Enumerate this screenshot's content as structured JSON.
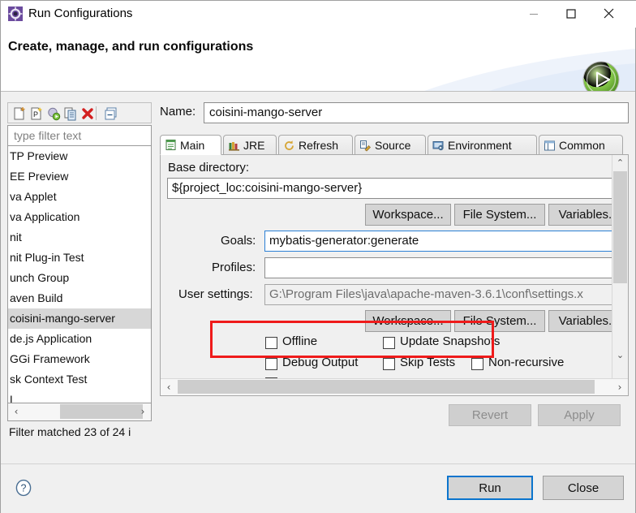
{
  "window": {
    "title": "Run Configurations",
    "title_icon": "gear-icon",
    "controls": {
      "minimize": "—",
      "maximize": "☐",
      "close": "✕"
    }
  },
  "header": {
    "title": "Create, manage, and run configurations",
    "badge_icon": "green-run-play-icon"
  },
  "sidebar": {
    "toolbar": [
      {
        "name": "new-configuration-icon"
      },
      {
        "name": "new-prototype-icon"
      },
      {
        "name": "run-filter-icon"
      },
      {
        "name": "duplicate-icon"
      },
      {
        "name": "delete-icon"
      },
      {
        "name": "collapse-all-icon"
      }
    ],
    "filter": {
      "placeholder": "type filter text",
      "value": ""
    },
    "items": [
      {
        "label": "TP Preview",
        "selected": false
      },
      {
        "label": "EE Preview",
        "selected": false
      },
      {
        "label": "va Applet",
        "selected": false
      },
      {
        "label": "va Application",
        "selected": false
      },
      {
        "label": "nit",
        "selected": false
      },
      {
        "label": "nit Plug-in Test",
        "selected": false
      },
      {
        "label": "unch Group",
        "selected": false
      },
      {
        "label": "aven Build",
        "selected": false
      },
      {
        "label": "coisini-mango-server",
        "selected": true
      },
      {
        "label": "de.js Application",
        "selected": false
      },
      {
        "label": "GGi Framework",
        "selected": false
      },
      {
        "label": "sk Context Test",
        "selected": false
      },
      {
        "label": "L",
        "selected": false
      }
    ],
    "hscroll": {
      "left_arrow": "‹",
      "right_arrow": "›"
    },
    "status": "Filter matched 23 of 24 i"
  },
  "main": {
    "name_label": "Name:",
    "name_value": "coisini-mango-server",
    "tabs": [
      {
        "label": "Main",
        "icon": "main-tab-icon",
        "active": true
      },
      {
        "label": "JRE",
        "icon": "jre-tab-icon",
        "active": false
      },
      {
        "label": "Refresh",
        "icon": "refresh-tab-icon",
        "active": false
      },
      {
        "label": "Source",
        "icon": "source-tab-icon",
        "active": false
      },
      {
        "label": "Environment",
        "icon": "environment-tab-icon",
        "active": false
      },
      {
        "label": "Common",
        "icon": "common-tab-icon",
        "active": false
      }
    ],
    "base_directory": {
      "label": "Base directory:",
      "value": "${project_loc:coisini-mango-server}"
    },
    "buttons_row1": [
      {
        "label": "Workspace..."
      },
      {
        "label": "File System..."
      },
      {
        "label": "Variables.."
      }
    ],
    "goals": {
      "label": "Goals:",
      "value": "mybatis-generator:generate"
    },
    "profiles": {
      "label": "Profiles:",
      "value": ""
    },
    "user_settings": {
      "label": "User settings:",
      "value": "G:\\Program Files\\java\\apache-maven-3.6.1\\conf\\settings.x"
    },
    "buttons_row2": [
      {
        "label": "Workspace..."
      },
      {
        "label": "File System..."
      },
      {
        "label": "Variables.."
      }
    ],
    "checkboxes": [
      {
        "label": "Offline",
        "checked": false
      },
      {
        "label": "Update Snapshots",
        "checked": false
      },
      {
        "label": "Debug Output",
        "checked": false
      },
      {
        "label": "Skip Tests",
        "checked": false
      },
      {
        "label": "Non-recursive",
        "checked": false
      }
    ],
    "vscroll": {
      "up_arrow": "⌃",
      "down_arrow": "⌄"
    },
    "hscroll": {
      "left_arrow": "‹",
      "right_arrow": "›"
    },
    "revert_label": "Revert",
    "apply_label": "Apply"
  },
  "footer": {
    "help_icon": "help-question-icon",
    "run_label": "Run",
    "close_label": "Close"
  },
  "annotation": {
    "color": "#ef1b1b",
    "target": "goals-field"
  }
}
